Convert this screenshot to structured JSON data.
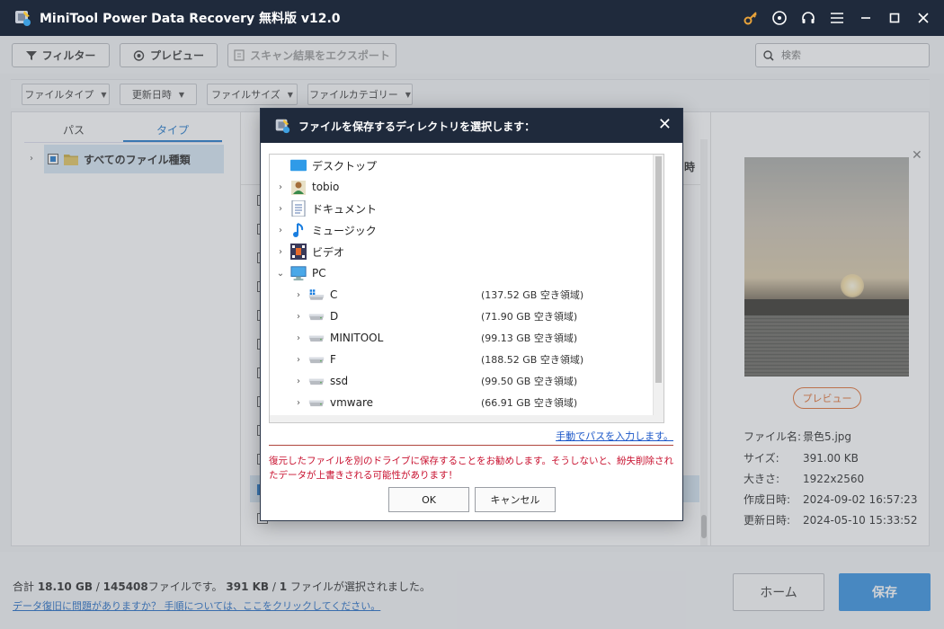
{
  "app": {
    "title": "MiniTool Power Data Recovery 無料版 v12.0"
  },
  "toolbar": {
    "filter_label": "フィルター",
    "preview_label": "プレビュー",
    "export_label": "スキャン結果をエクスポート",
    "search_placeholder": "検索"
  },
  "filters": [
    {
      "label": "ファイルタイプ"
    },
    {
      "label": "更新日時"
    },
    {
      "label": "ファイルサイズ"
    },
    {
      "label": "ファイルカテゴリー"
    }
  ],
  "left_panel": {
    "tabs": [
      {
        "label": "パス"
      },
      {
        "label": "タイプ",
        "active": true
      }
    ],
    "tree_item": "すべてのファイル種類"
  },
  "mid_panel": {
    "header_fragment": "時"
  },
  "preview_panel": {
    "preview_button": "プレビュー",
    "info": [
      {
        "key": "ファイル名:",
        "value": "景色5.jpg"
      },
      {
        "key": "サイズ:",
        "value": "391.00 KB"
      },
      {
        "key": "大きさ:",
        "value": "1922x2560"
      },
      {
        "key": "作成日時:",
        "value": "2024-09-02 16:57:23"
      },
      {
        "key": "更新日時:",
        "value": "2024-05-10 15:33:52"
      }
    ]
  },
  "bottom": {
    "summary_prefix": "合計 ",
    "total_size": "18.10 GB",
    "slash": " / ",
    "total_files": "145408",
    "summary_mid": "ファイルです。  ",
    "selected_size": "391 KB",
    "selected_files": "1",
    "summary_suffix": " ファイルが選択されました。",
    "help_link": "データ復旧に問題がありますか？ 手順については、ここをクリックしてください。",
    "home_label": "ホーム",
    "save_label": "保存"
  },
  "dialog": {
    "title": "ファイルを保存するディレクトリを選択します：",
    "tree": [
      {
        "label": "デスクトップ",
        "level": 0,
        "arrow": "",
        "icon": "desktop-icon",
        "free": ""
      },
      {
        "label": "tobio",
        "level": 1,
        "arrow": "›",
        "icon": "user-icon",
        "free": ""
      },
      {
        "label": "ドキュメント",
        "level": 1,
        "arrow": "›",
        "icon": "document-icon",
        "free": ""
      },
      {
        "label": "ミュージック",
        "level": 1,
        "arrow": "›",
        "icon": "music-icon",
        "free": ""
      },
      {
        "label": "ビデオ",
        "level": 1,
        "arrow": "›",
        "icon": "video-icon",
        "free": ""
      },
      {
        "label": "PC",
        "level": 1,
        "arrow": "⌄",
        "icon": "pc-icon",
        "free": ""
      },
      {
        "label": "C",
        "level": 2,
        "arrow": "›",
        "icon": "windows-drive-icon",
        "free": "(137.52 GB 空き領域)"
      },
      {
        "label": "D",
        "level": 2,
        "arrow": "›",
        "icon": "drive-icon",
        "free": "(71.90 GB 空き領域)"
      },
      {
        "label": "MINITOOL",
        "level": 2,
        "arrow": "›",
        "icon": "drive-icon",
        "free": "(99.13 GB 空き領域)"
      },
      {
        "label": "F",
        "level": 2,
        "arrow": "›",
        "icon": "drive-icon",
        "free": "(188.52 GB 空き領域)"
      },
      {
        "label": "ssd",
        "level": 2,
        "arrow": "›",
        "icon": "drive-icon",
        "free": "(99.50 GB 空き領域)"
      },
      {
        "label": "vmware",
        "level": 2,
        "arrow": "›",
        "icon": "drive-icon",
        "free": "(66.91 GB 空き領域)"
      }
    ],
    "manual_link": "手動でパスを入力します。",
    "warning": "復元したファイルを別のドライブに保存することをお勧めします。そうしないと、紛失削除されたデータが上書きされる可能性があります！",
    "ok_label": "OK",
    "cancel_label": "キャンセル"
  },
  "colors": {
    "titlebar": "#1f2a3c",
    "accent": "#2f8ee0",
    "warning": "#c8102e",
    "preview_accent": "#e06b2c"
  }
}
